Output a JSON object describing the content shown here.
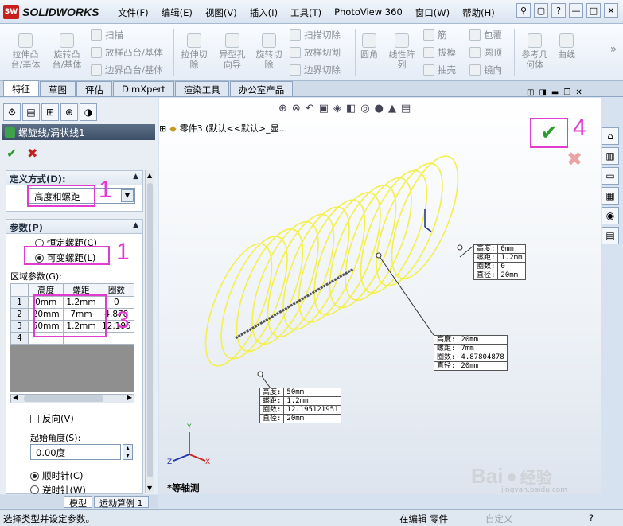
{
  "app": {
    "logo_mark": "SW",
    "logo_text": "SOLIDWORKS"
  },
  "menu": [
    "文件(F)",
    "编辑(E)",
    "视图(V)",
    "插入(I)",
    "工具(T)",
    "PhotoView 360",
    "窗口(W)",
    "帮助(H)"
  ],
  "toolbar": {
    "extrude_boss": "拉伸凸台/基体",
    "revolve_boss": "旋转凸台/基体",
    "sweep": "扫描",
    "loft": "放样凸台/基体",
    "boundary": "边界凸台/基体",
    "extrude_cut": "拉伸切除",
    "hole_wizard": "异型孔向导",
    "revolve_cut": "旋转切除",
    "sweep_cut": "扫描切除",
    "loft_cut": "放样切割",
    "boundary_cut": "边界切除",
    "fillet": "圆角",
    "linear_pattern": "线性阵列",
    "rib": "筋",
    "draft": "拔模",
    "shell": "抽壳",
    "wrap": "包覆",
    "dome": "圆顶",
    "mirror": "镜向",
    "ref_geometry": "参考几何体",
    "curves": "曲线"
  },
  "tabs": [
    "特征",
    "草图",
    "评估",
    "DimXpert",
    "渲染工具",
    "办公室产品"
  ],
  "feature": {
    "title": "螺旋线/涡状线1",
    "definition_header": "定义方式(D):",
    "definition_value": "高度和螺距",
    "params_header": "参数(P)",
    "constant_pitch": "恒定螺距(C)",
    "variable_pitch": "可变螺距(L)",
    "region_params": "区域参数(G):",
    "table_headers": [
      "高度",
      "螺距",
      "圈数"
    ],
    "rows": [
      {
        "n": "1",
        "height": "0mm",
        "pitch": "1.2mm",
        "turns": "0"
      },
      {
        "n": "2",
        "height": "20mm",
        "pitch": "7mm",
        "turns": "4.878"
      },
      {
        "n": "3",
        "height": "50mm",
        "pitch": "1.2mm",
        "turns": "12.195"
      },
      {
        "n": "4",
        "height": "",
        "pitch": "",
        "turns": ""
      }
    ],
    "reverse": "反向(V)",
    "start_angle_label": "起始角度(S):",
    "start_angle_value": "0.00度",
    "clockwise": "顺时针(C)",
    "counterclockwise": "逆时针(W)"
  },
  "annotations": {
    "n1": "1",
    "n2": "1",
    "n3": "3",
    "n4": "4"
  },
  "viewport": {
    "tree_label": "零件3  (默认<<默认>_显...",
    "view_name": "*等轴测",
    "callout_top": [
      [
        "高度:",
        "0mm"
      ],
      [
        "螺距:",
        "1.2mm"
      ],
      [
        "圈数:",
        "0"
      ],
      [
        "直径:",
        "20mm"
      ]
    ],
    "callout_mid": [
      [
        "高度:",
        "20mm"
      ],
      [
        "螺距:",
        "7mm"
      ],
      [
        "圈数:",
        "4.87804878"
      ],
      [
        "直径:",
        "20mm"
      ]
    ],
    "callout_bottom": [
      [
        "高度:",
        "50mm"
      ],
      [
        "螺距:",
        "1.2mm"
      ],
      [
        "圈数:",
        "12.195121951"
      ],
      [
        "直径:",
        "20mm"
      ]
    ],
    "axis_x": "X",
    "axis_y": "Y",
    "axis_z": "Z",
    "watermark_main": "Bai",
    "watermark_jing": "经验",
    "watermark_url": "jingyan.baidu.com"
  },
  "bottom_tabs": [
    "模型",
    "运动算例 1"
  ],
  "status": {
    "left": "选择类型并设定参数。",
    "mode": "在编辑 零件",
    "custom": "自定义"
  },
  "colors": {
    "helix": "#f3f04a",
    "accent": "#e13ccf",
    "ok": "#2e9b2e",
    "cancel": "#c42121"
  }
}
